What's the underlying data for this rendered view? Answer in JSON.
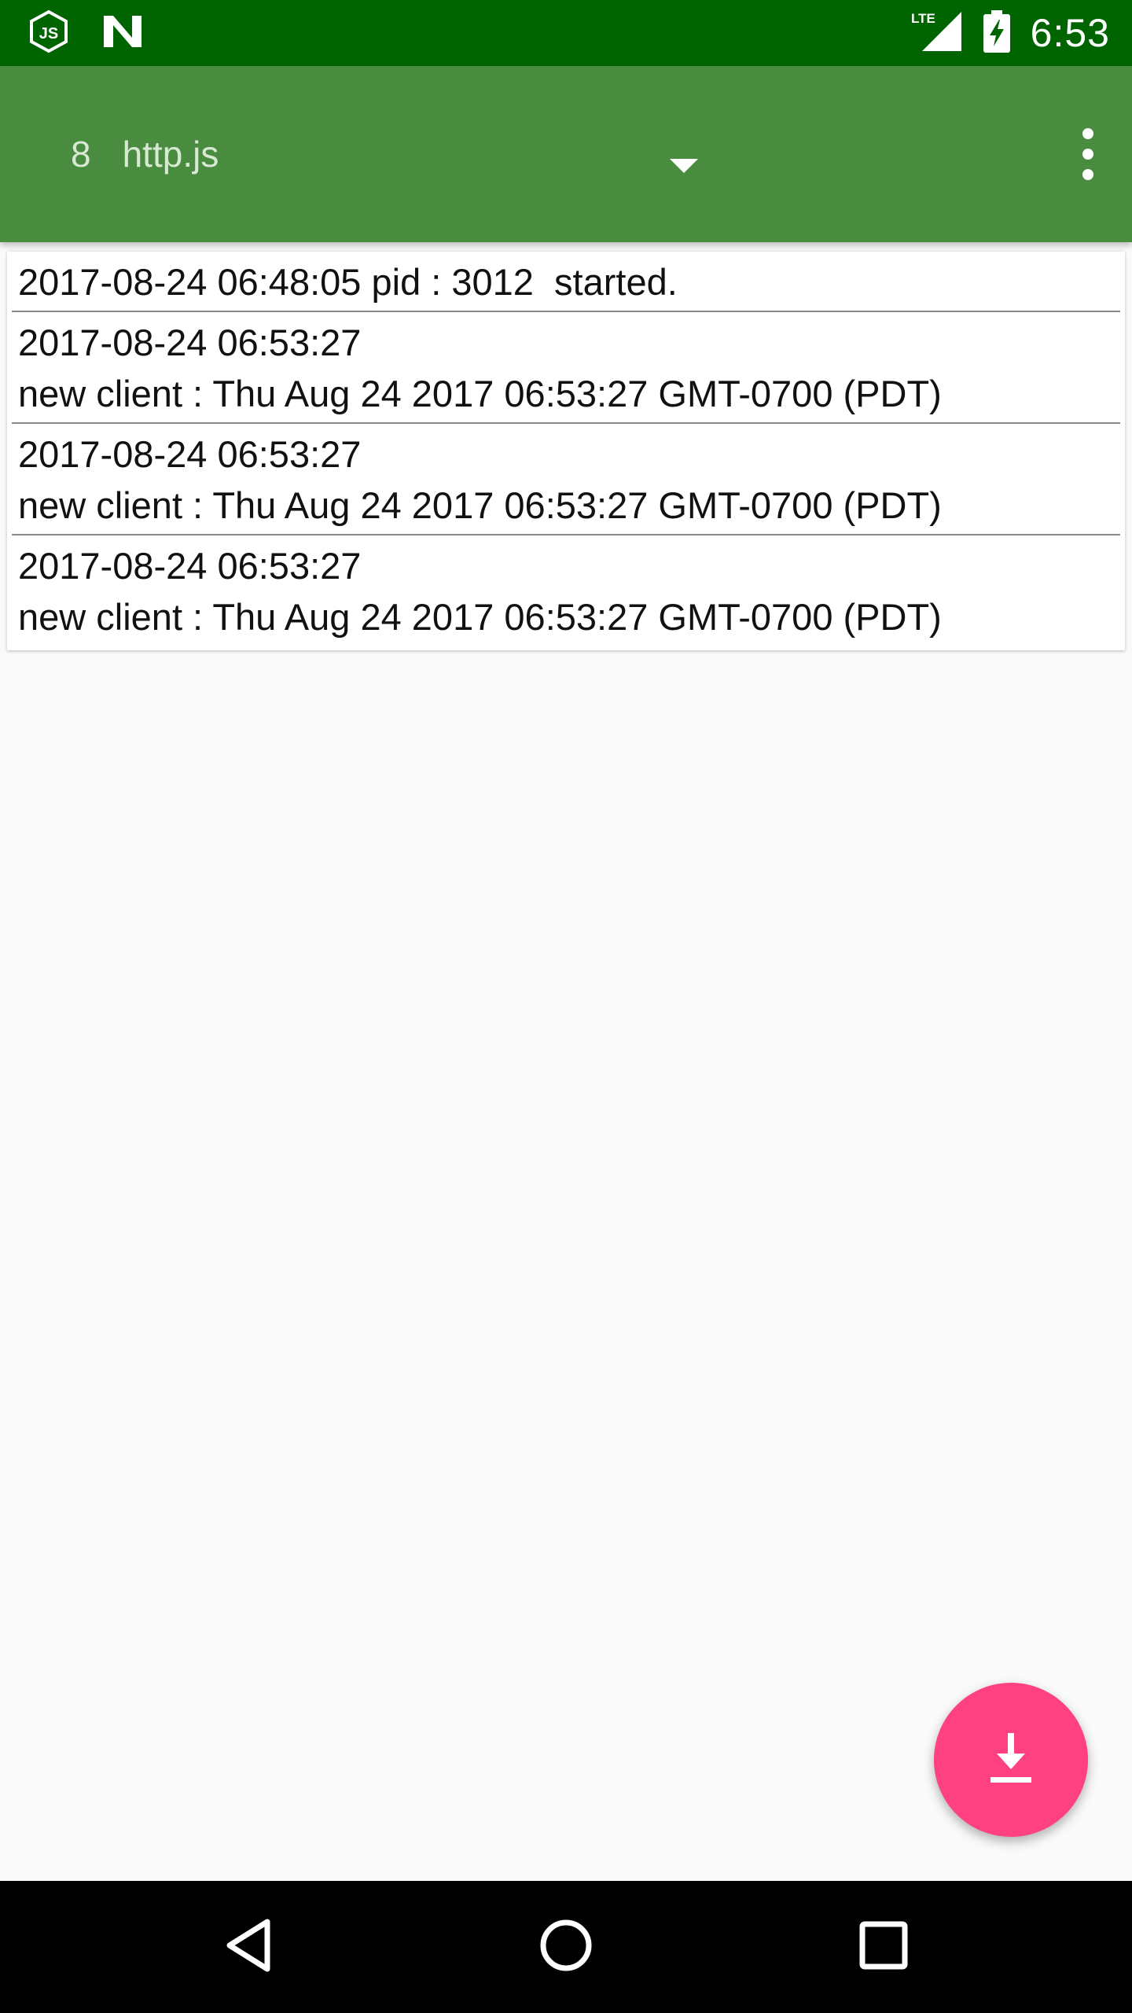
{
  "status_bar": {
    "time": "6:53",
    "network": "LTE",
    "left_icons": [
      "nodejs-icon",
      "app-n-icon"
    ],
    "right_icons": [
      "lte-signal-icon",
      "battery-charging-icon"
    ]
  },
  "toolbar": {
    "spinner": {
      "index": "8",
      "label": "http.js"
    }
  },
  "log_entries": [
    {
      "lines": [
        "2017-08-24 06:48:05 pid : 3012  started."
      ]
    },
    {
      "lines": [
        "2017-08-24 06:53:27",
        "new client : Thu Aug 24 2017 06:53:27 GMT-0700 (PDT)"
      ]
    },
    {
      "lines": [
        "2017-08-24 06:53:27",
        "new client : Thu Aug 24 2017 06:53:27 GMT-0700 (PDT)"
      ]
    },
    {
      "lines": [
        "2017-08-24 06:53:27",
        "new client : Thu Aug 24 2017 06:53:27 GMT-0700 (PDT)"
      ]
    }
  ],
  "fab": {
    "icon": "download-icon"
  },
  "nav_bar": {
    "icons": [
      "back-icon",
      "home-icon",
      "recents-icon"
    ]
  },
  "colors": {
    "status_bar": "#006400",
    "toolbar": "#498b3f",
    "fab": "#ff4081",
    "background": "#fafafa"
  }
}
